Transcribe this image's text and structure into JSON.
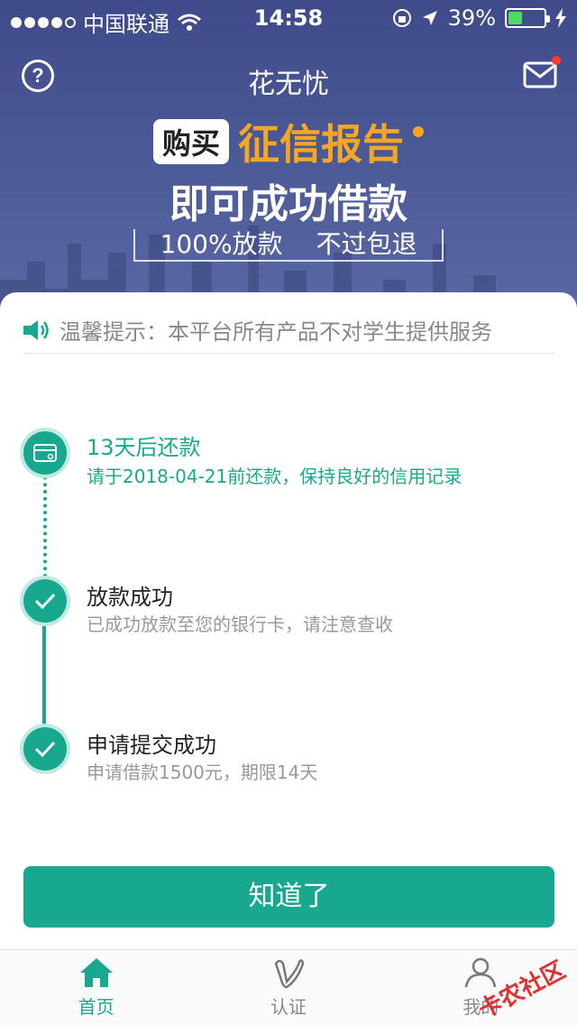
{
  "status_bar": {
    "carrier": "中国联通",
    "time": "14:58",
    "battery": "39%",
    "battery_level": 0.39
  },
  "nav": {
    "title": "花无忧",
    "help_symbol": "?"
  },
  "banner": {
    "buy_badge": "购买",
    "credit_report": "征信报告",
    "headline": "即可成功借款",
    "tag_left": "100%放款",
    "tag_right": "不过包退"
  },
  "notice": {
    "text": "温馨提示：本平台所有产品不对学生提供服务"
  },
  "timeline": {
    "steps": [
      {
        "title": "13天后还款",
        "desc": "请于2018-04-21前还款，保持良好的信用记录",
        "icon": "card-icon"
      },
      {
        "title": "放款成功",
        "desc": "已成功放款至您的银行卡，请注意查收",
        "icon": "check-icon"
      },
      {
        "title": "申请提交成功",
        "desc": "申请借款1500元，期限14天",
        "icon": "check-icon"
      }
    ]
  },
  "ok_button": {
    "label": "知道了"
  },
  "tabbar": {
    "items": [
      {
        "label": "首页",
        "icon": "home-icon",
        "active": true
      },
      {
        "label": "认证",
        "icon": "verify-icon",
        "active": false
      },
      {
        "label": "我的",
        "icon": "profile-icon",
        "active": false
      }
    ]
  },
  "watermark": "卡农社区",
  "colors": {
    "accent": "#17a88f",
    "header": "#4b5896",
    "highlight": "#f5a623"
  }
}
